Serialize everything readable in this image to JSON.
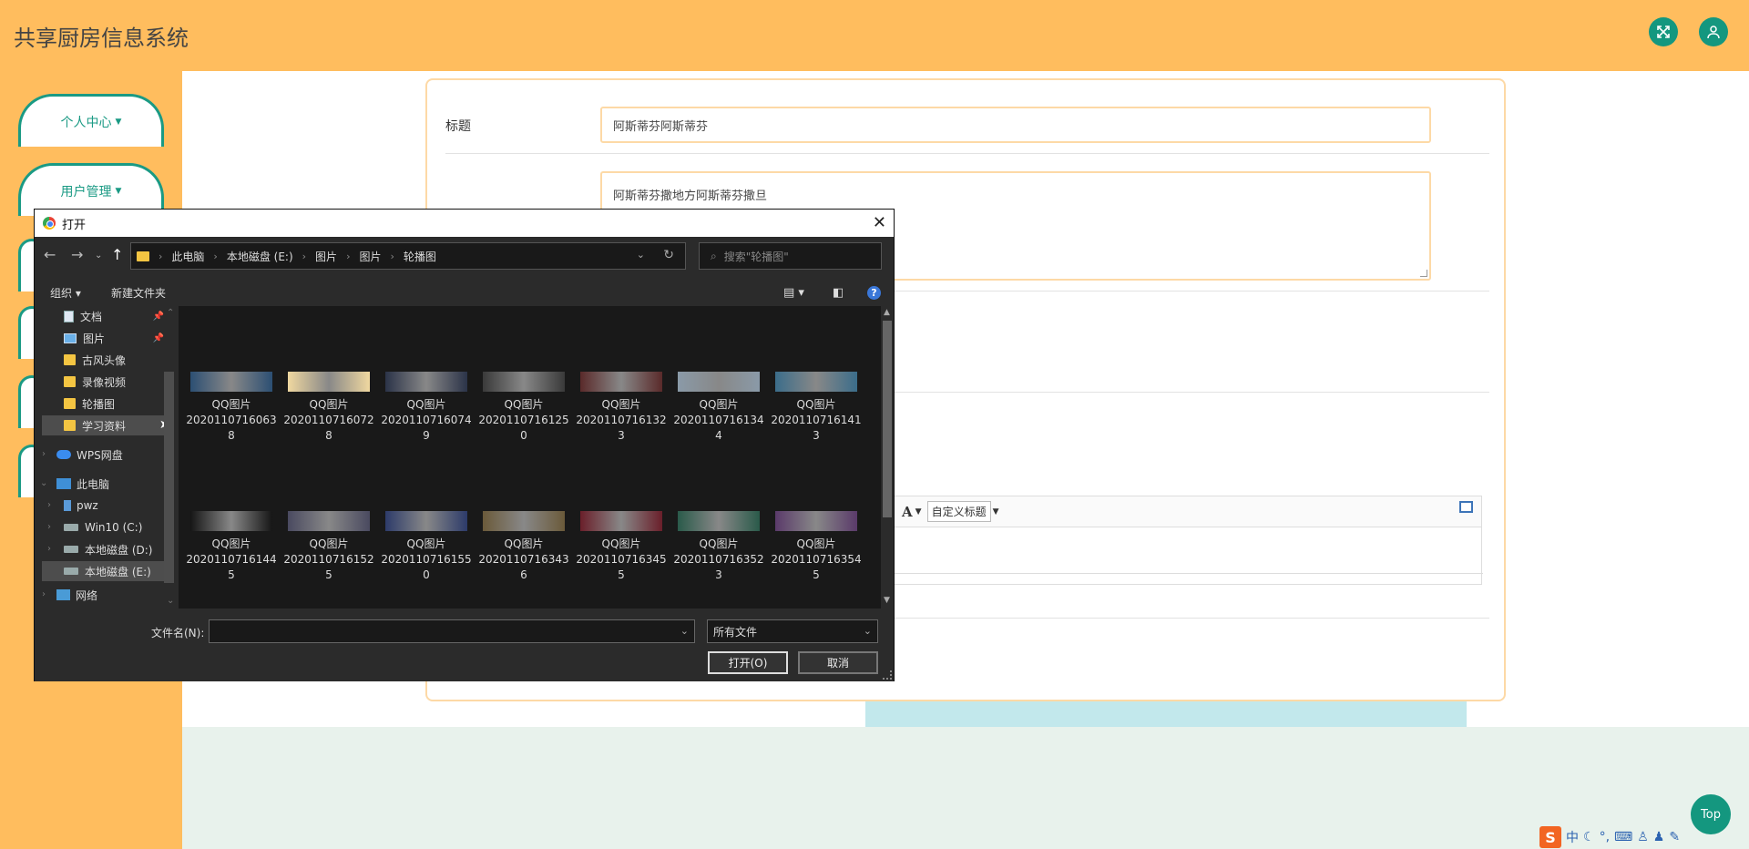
{
  "app": {
    "title": "共享厨房信息系统"
  },
  "colors": {
    "primary": "#14977f",
    "header_bg": "#ffbd5e",
    "input_border": "#fdd9a6"
  },
  "sidebar": {
    "items": [
      {
        "label": "个人中心",
        "caret": "▼"
      },
      {
        "label": "用户管理",
        "caret": "▼"
      }
    ]
  },
  "form": {
    "title_label": "标题",
    "title_value": "阿斯蒂芬阿斯蒂芬",
    "desc_value": "阿斯蒂芬撒地方阿斯蒂芬撒旦"
  },
  "editor": {
    "font_icon": "A",
    "heading_select": "自定义标题"
  },
  "back_to_top": "Top",
  "ime": {
    "logo": "S",
    "mode": "中"
  },
  "dialog": {
    "title": "打开",
    "breadcrumb": [
      "此电脑",
      "本地磁盘 (E:)",
      "图片",
      "图片",
      "轮播图"
    ],
    "search_placeholder": "搜索\"轮播图\"",
    "toolbar": {
      "organize": "组织 ▾",
      "new_folder": "新建文件夹",
      "help": "?"
    },
    "nav": {
      "quick": [
        {
          "label": "文档",
          "icon": "document-icon",
          "pinned": true
        },
        {
          "label": "图片",
          "icon": "pictures-icon",
          "pinned": true
        },
        {
          "label": "古风头像",
          "icon": "folder-icon"
        },
        {
          "label": "录像视频",
          "icon": "folder-icon"
        },
        {
          "label": "轮播图",
          "icon": "folder-icon"
        },
        {
          "label": "学习资料",
          "icon": "folder-icon"
        }
      ],
      "wps": "WPS网盘",
      "this_pc": "此电脑",
      "drives": [
        {
          "label": "pwz",
          "icon": "user-folder-icon"
        },
        {
          "label": "Win10 (C:)",
          "icon": "drive-icon"
        },
        {
          "label": "本地磁盘 (D:)",
          "icon": "drive-icon"
        },
        {
          "label": "本地磁盘 (E:)",
          "icon": "drive-icon"
        }
      ],
      "network": "网络"
    },
    "files": [
      {
        "name": "QQ图片",
        "id": "2020110716063",
        "tail": "8",
        "color": "#2c4f73"
      },
      {
        "name": "QQ图片",
        "id": "2020110716072",
        "tail": "8",
        "color": "#f0d8a0"
      },
      {
        "name": "QQ图片",
        "id": "2020110716074",
        "tail": "9",
        "color": "#2b3348"
      },
      {
        "name": "QQ图片",
        "id": "2020110716125",
        "tail": "0",
        "color": "#3a3a3a"
      },
      {
        "name": "QQ图片",
        "id": "2020110716132",
        "tail": "3",
        "color": "#5a2a2a"
      },
      {
        "name": "QQ图片",
        "id": "2020110716134",
        "tail": "4",
        "color": "#8a9aa8"
      },
      {
        "name": "QQ图片",
        "id": "2020110716141",
        "tail": "3",
        "color": "#3b6d8a"
      },
      {
        "name": "QQ图片",
        "id": "2020110716144",
        "tail": "5",
        "color": "#161616"
      },
      {
        "name": "QQ图片",
        "id": "2020110716152",
        "tail": "5",
        "color": "#4a4a60"
      },
      {
        "name": "QQ图片",
        "id": "2020110716155",
        "tail": "0",
        "color": "#2d3b6a"
      },
      {
        "name": "QQ图片",
        "id": "2020110716343",
        "tail": "6",
        "color": "#6b5a3a"
      },
      {
        "name": "QQ图片",
        "id": "2020110716345",
        "tail": "5",
        "color": "#6a1f2a"
      },
      {
        "name": "QQ图片",
        "id": "2020110716352",
        "tail": "3",
        "color": "#2a5a4a"
      },
      {
        "name": "QQ图片",
        "id": "2020110716354",
        "tail": "5",
        "color": "#5a3a6a"
      }
    ],
    "filename_label": "文件名(N):",
    "filename_value": "",
    "filetype": "所有文件",
    "open_button": "打开(O)",
    "cancel_button": "取消"
  }
}
